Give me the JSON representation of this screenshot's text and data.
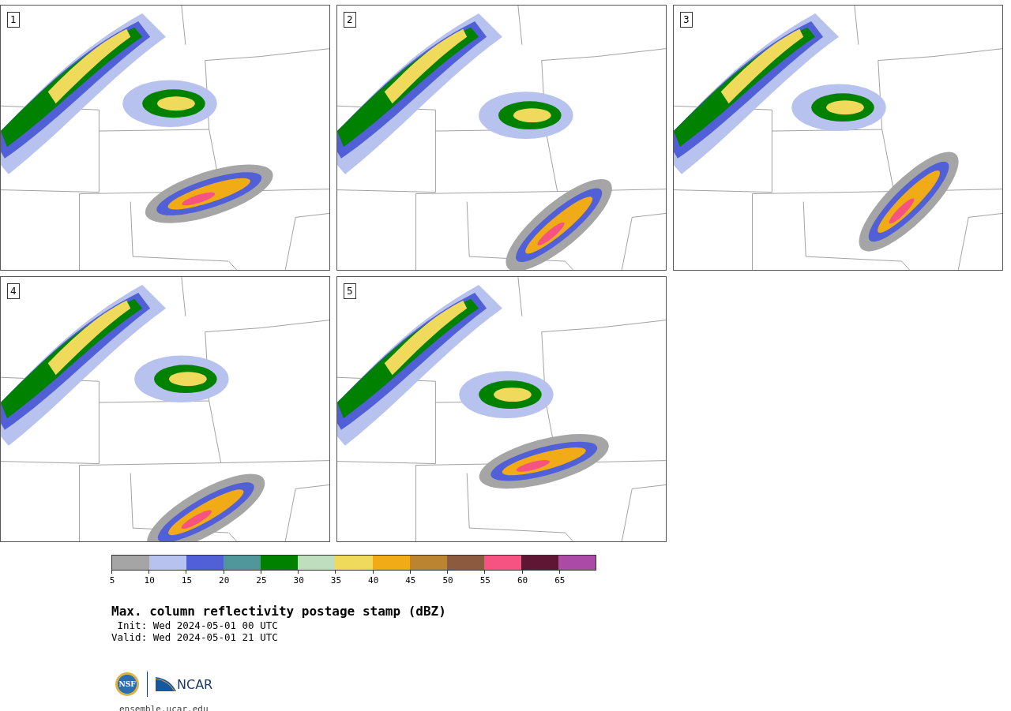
{
  "panels": [
    {
      "label": "1"
    },
    {
      "label": "2"
    },
    {
      "label": "3"
    },
    {
      "label": "4"
    },
    {
      "label": "5"
    }
  ],
  "colorbar": {
    "bins": [
      {
        "color": "#a5a5a5"
      },
      {
        "color": "#b7c2ee"
      },
      {
        "color": "#5160d6"
      },
      {
        "color": "#50979b"
      },
      {
        "color": "#008200"
      },
      {
        "color": "#bfdebe"
      },
      {
        "color": "#f0da5c"
      },
      {
        "color": "#f0ab17"
      },
      {
        "color": "#bb8430"
      },
      {
        "color": "#8b5a3f"
      },
      {
        "color": "#f65282"
      },
      {
        "color": "#5f1634"
      },
      {
        "color": "#ac4aa7"
      }
    ],
    "ticks": [
      "5",
      "10",
      "15",
      "20",
      "25",
      "30",
      "35",
      "40",
      "45",
      "50",
      "55",
      "60",
      "65"
    ]
  },
  "title": "Max. column reflectivity postage stamp (dBZ)",
  "init": " Init: Wed 2024-05-01 00 UTC",
  "valid": "Valid: Wed 2024-05-01 21 UTC",
  "logos": {
    "nsf": "NSF",
    "ncar": "NCAR"
  },
  "url": "ensemble.ucar.edu"
}
